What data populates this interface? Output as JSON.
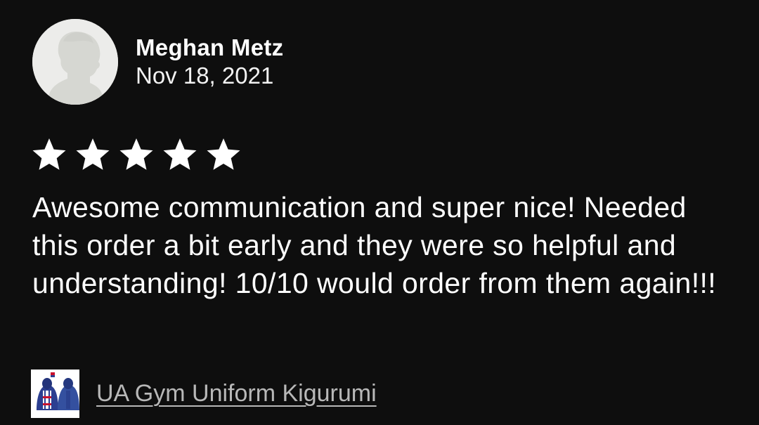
{
  "review": {
    "reviewer_name": "Meghan Metz",
    "date": "Nov 18, 2021",
    "rating": 5,
    "max_rating": 5,
    "text": "Awesome communication and super nice! Needed this order a bit early and they were so helpful and understanding! 10/10 would order from them again!!!"
  },
  "product": {
    "name": "UA Gym Uniform Kigurumi",
    "thumbnail_icon": "kigurumi-product-image"
  },
  "colors": {
    "background": "#0e0e0e",
    "text": "#ffffff",
    "link": "#b8b8b8",
    "avatar_bg": "#ececea"
  }
}
